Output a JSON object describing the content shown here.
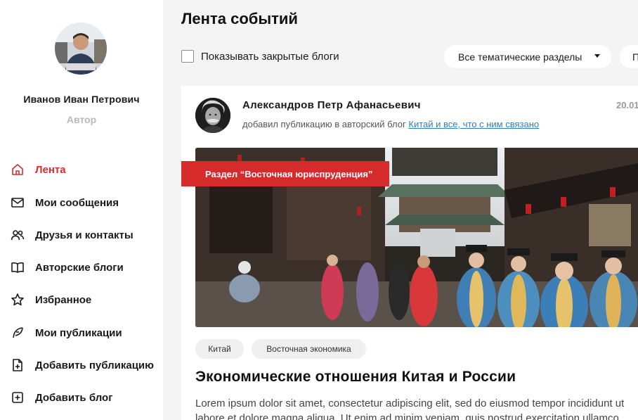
{
  "user": {
    "name": "Иванов Иван Петрович",
    "role": "Автор"
  },
  "sidebar": {
    "items": [
      {
        "label": "Лента",
        "icon": "home-icon",
        "active": true
      },
      {
        "label": "Мои сообщения",
        "icon": "mail-icon",
        "active": false
      },
      {
        "label": "Друзья и контакты",
        "icon": "users-icon",
        "active": false
      },
      {
        "label": "Авторские блоги",
        "icon": "book-icon",
        "active": false
      },
      {
        "label": "Избранное",
        "icon": "star-icon",
        "active": false
      },
      {
        "label": "Мои публикации",
        "icon": "feather-icon",
        "active": false
      },
      {
        "label": "Добавить публикацию",
        "icon": "file-plus-icon",
        "active": false
      },
      {
        "label": "Добавить блог",
        "icon": "square-plus-icon",
        "active": false
      }
    ]
  },
  "main": {
    "title": "Лента событий",
    "filters": {
      "show_closed_label": "Показывать закрытые блоги",
      "show_closed_checked": false,
      "section_select": "Все тематические разделы",
      "second_select": "П"
    }
  },
  "post": {
    "author": "Александров Петр Афанасьевич",
    "action_text": "добавил публикацию в авторский блог ",
    "blog_link": "Китай и все, что с ним связано",
    "date": "20.01",
    "section_badge": "Раздел “Восточная юриспруденция”",
    "tags": [
      "Китай",
      "Восточная экономика"
    ],
    "title": "Экономические отношения Китая и России",
    "excerpt_line1": "Lorem ipsum dolor sit amet, consectetur adipiscing elit, sed do eiusmod tempor incididunt ut",
    "excerpt_line2": "labore et dolore magna aliqua. Ut enim ad minim veniam, quis nostrud exercitation ullamco"
  },
  "colors": {
    "accent": "#d62b2b",
    "link": "#2f7fbf",
    "muted": "#b9b9b9",
    "page_bg": "#f4f4f4"
  }
}
